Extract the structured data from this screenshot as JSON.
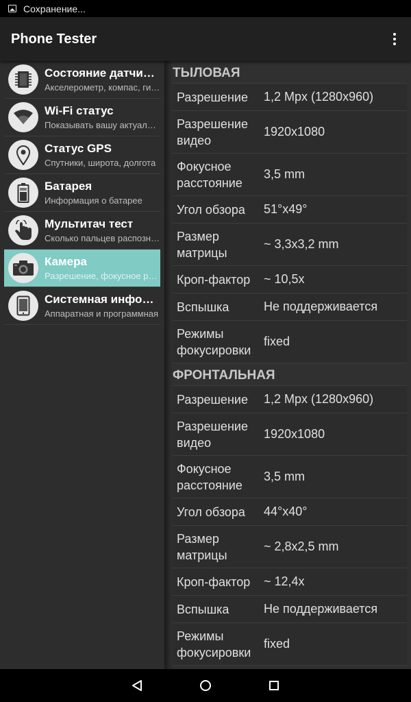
{
  "status_bar": {
    "text": "Сохранение..."
  },
  "toolbar": {
    "title": "Phone Tester"
  },
  "sidebar": {
    "items": [
      {
        "icon": "chip-icon",
        "title": "Состояние датчиков",
        "subtitle": "Акселерометр, компас, гироскоп",
        "active": false
      },
      {
        "icon": "wifi-icon",
        "title": "Wi-Fi статус",
        "subtitle": "Показывать вашу актуальную",
        "active": false
      },
      {
        "icon": "location-pin-icon",
        "title": "Статус GPS",
        "subtitle": "Спутники, широта, долгота",
        "active": false
      },
      {
        "icon": "battery-icon",
        "title": "Батарея",
        "subtitle": "Информация о батарее",
        "active": false
      },
      {
        "icon": "hand-touch-icon",
        "title": "Мультитач тест",
        "subtitle": "Сколько пальцев распознаёт",
        "active": false
      },
      {
        "icon": "camera-icon",
        "title": "Камера",
        "subtitle": "Разрешение, фокусное расстояние",
        "active": true
      },
      {
        "icon": "phone-icon",
        "title": "Системная информация",
        "subtitle": "Аппаратная и программная",
        "active": false
      }
    ]
  },
  "rear": {
    "header": "ТЫЛОВАЯ",
    "rows": [
      {
        "label": "Разрешение",
        "value": "1,2 Mpx (1280x960)"
      },
      {
        "label": "Разрешение видео",
        "value": "1920x1080"
      },
      {
        "label": "Фокусное расстояние",
        "value": "3,5 mm"
      },
      {
        "label": "Угол обзора",
        "value": "51°x49°"
      },
      {
        "label": "Размер матрицы",
        "value": "~ 3,3x3,2 mm"
      },
      {
        "label": "Кроп-фактор",
        "value": "~ 10,5x"
      },
      {
        "label": "Вспышка",
        "value": "Не поддерживается"
      },
      {
        "label": "Режимы фокусировки",
        "value": "fixed"
      }
    ]
  },
  "front": {
    "header": "ФРОНТАЛЬНАЯ",
    "rows": [
      {
        "label": "Разрешение",
        "value": "1,2 Mpx (1280x960)"
      },
      {
        "label": "Разрешение видео",
        "value": "1920x1080"
      },
      {
        "label": "Фокусное расстояние",
        "value": "3,5 mm"
      },
      {
        "label": "Угол обзора",
        "value": "44°x40°"
      },
      {
        "label": "Размер матрицы",
        "value": "~ 2,8x2,5 mm"
      },
      {
        "label": "Кроп-фактор",
        "value": "~ 12,4x"
      },
      {
        "label": "Вспышка",
        "value": "Не поддерживается"
      },
      {
        "label": "Режимы фокусировки",
        "value": "fixed"
      }
    ]
  },
  "colors": {
    "accent": "#80cbc4",
    "toolbar": "#212121",
    "background": "#303030"
  }
}
